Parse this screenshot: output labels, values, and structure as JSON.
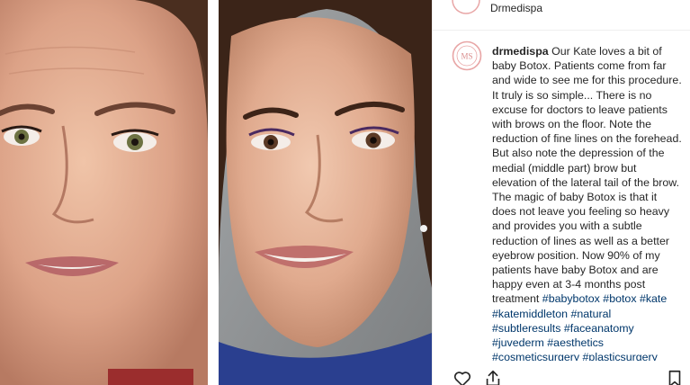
{
  "post": {
    "header_username": "Drmedispa",
    "avatar_text": "MS",
    "caption": {
      "username": "drmedispa",
      "text": "Our Kate loves a bit of baby Botox. Patients come from far and wide to see me for this procedure. It truly is so simple... There is no excuse for doctors to leave patients with brows on the floor. Note the reduction of fine lines on the forehead. But also note the depression of the medial (middle part) brow but elevation of the lateral tail of the brow. The magic of baby Botox is that it does not leave you feeling so heavy and provides you with a subtle reduction of lines as well as a better eyebrow position. Now 90% of my patients have baby Botox and are happy even at 3-4 months post treatment",
      "hashtags": "#babybotox #botox #kate #katemiddleton #natural #subtleresults #faceanatomy #juvederm #aesthetics #cosmeticsurgery #plasticsurgery #drsomji #drmedispa"
    },
    "icons": {
      "like": "heart-icon",
      "share": "share-icon",
      "save": "bookmark-icon"
    },
    "colors": {
      "hashtag": "#00376b",
      "avatar_ring": "#e8a5a5",
      "text": "#262626",
      "divider": "#efefef"
    }
  }
}
